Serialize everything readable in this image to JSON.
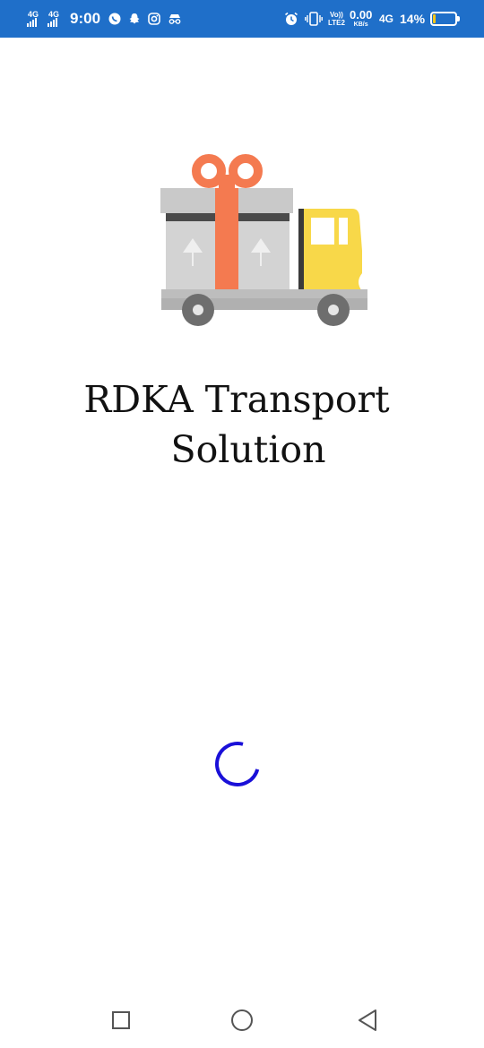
{
  "status_bar": {
    "net1": "4G",
    "net2": "4G",
    "time": "9:00",
    "volte_top": "Vo))",
    "volte_bottom": "LTE2",
    "speed_value": "0.00",
    "speed_unit": "KB/s",
    "net3": "4G",
    "battery_percent": "14%",
    "battery_level": 0.14,
    "accent": "#1f6fc9"
  },
  "splash": {
    "title_line1": "RDKA Transport",
    "title_line2": "Solution",
    "logo_icon": "delivery-truck-gift-icon",
    "spinner_color": "#1a10d8"
  },
  "nav_bar": {
    "recent": "square-icon",
    "home": "circle-icon",
    "back": "triangle-back-icon"
  }
}
